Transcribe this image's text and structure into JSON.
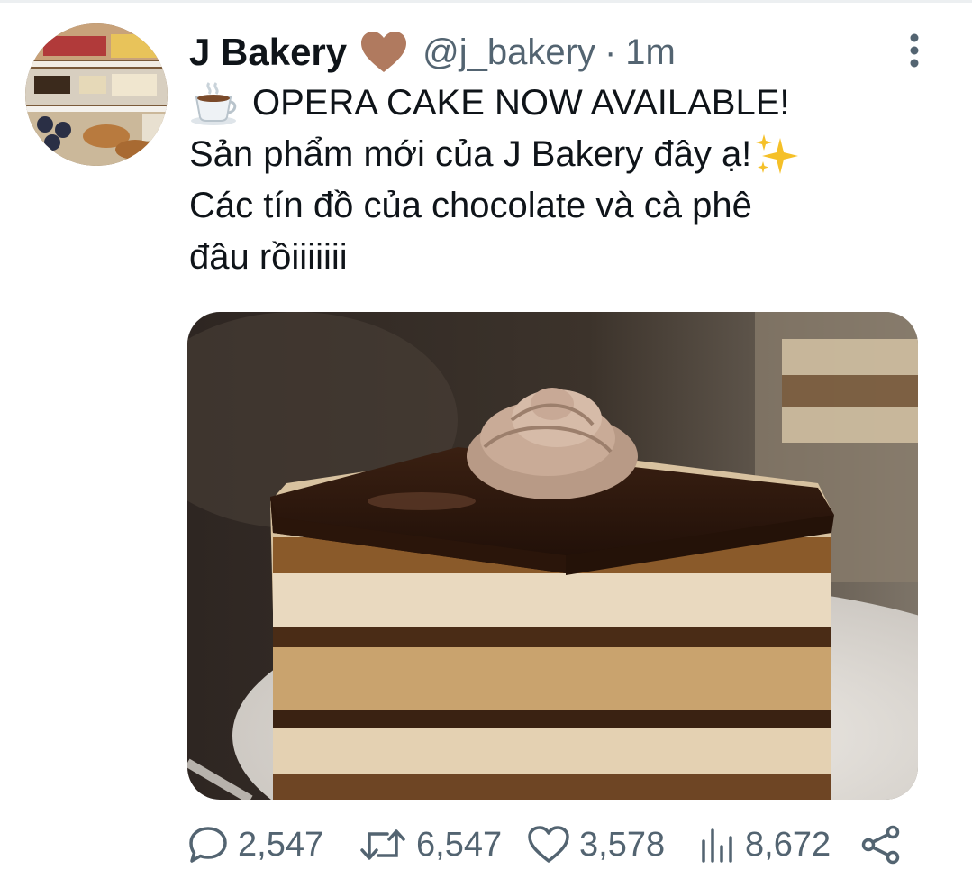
{
  "tweet": {
    "display_name": "J Bakery",
    "handle": "@j_bakery",
    "separator": "·",
    "time": "1m",
    "text_lines": [
      "OPERA CAKE NOW AVAILABLE!",
      "Sản phẩm mới của J Bakery đây ạ!",
      "Các tín đồ của chocolate và cà phê",
      "đâu rồiiiiiii"
    ],
    "emojis": [
      "hot-beverage",
      "sparkles"
    ],
    "name_emoji": "brown-heart"
  },
  "actions": {
    "replies": "2,547",
    "retweets": "6,547",
    "likes": "3,578",
    "views": "8,672"
  },
  "colors": {
    "text": "#0f1419",
    "secondary": "#536471",
    "heart": "#b07a5f"
  }
}
